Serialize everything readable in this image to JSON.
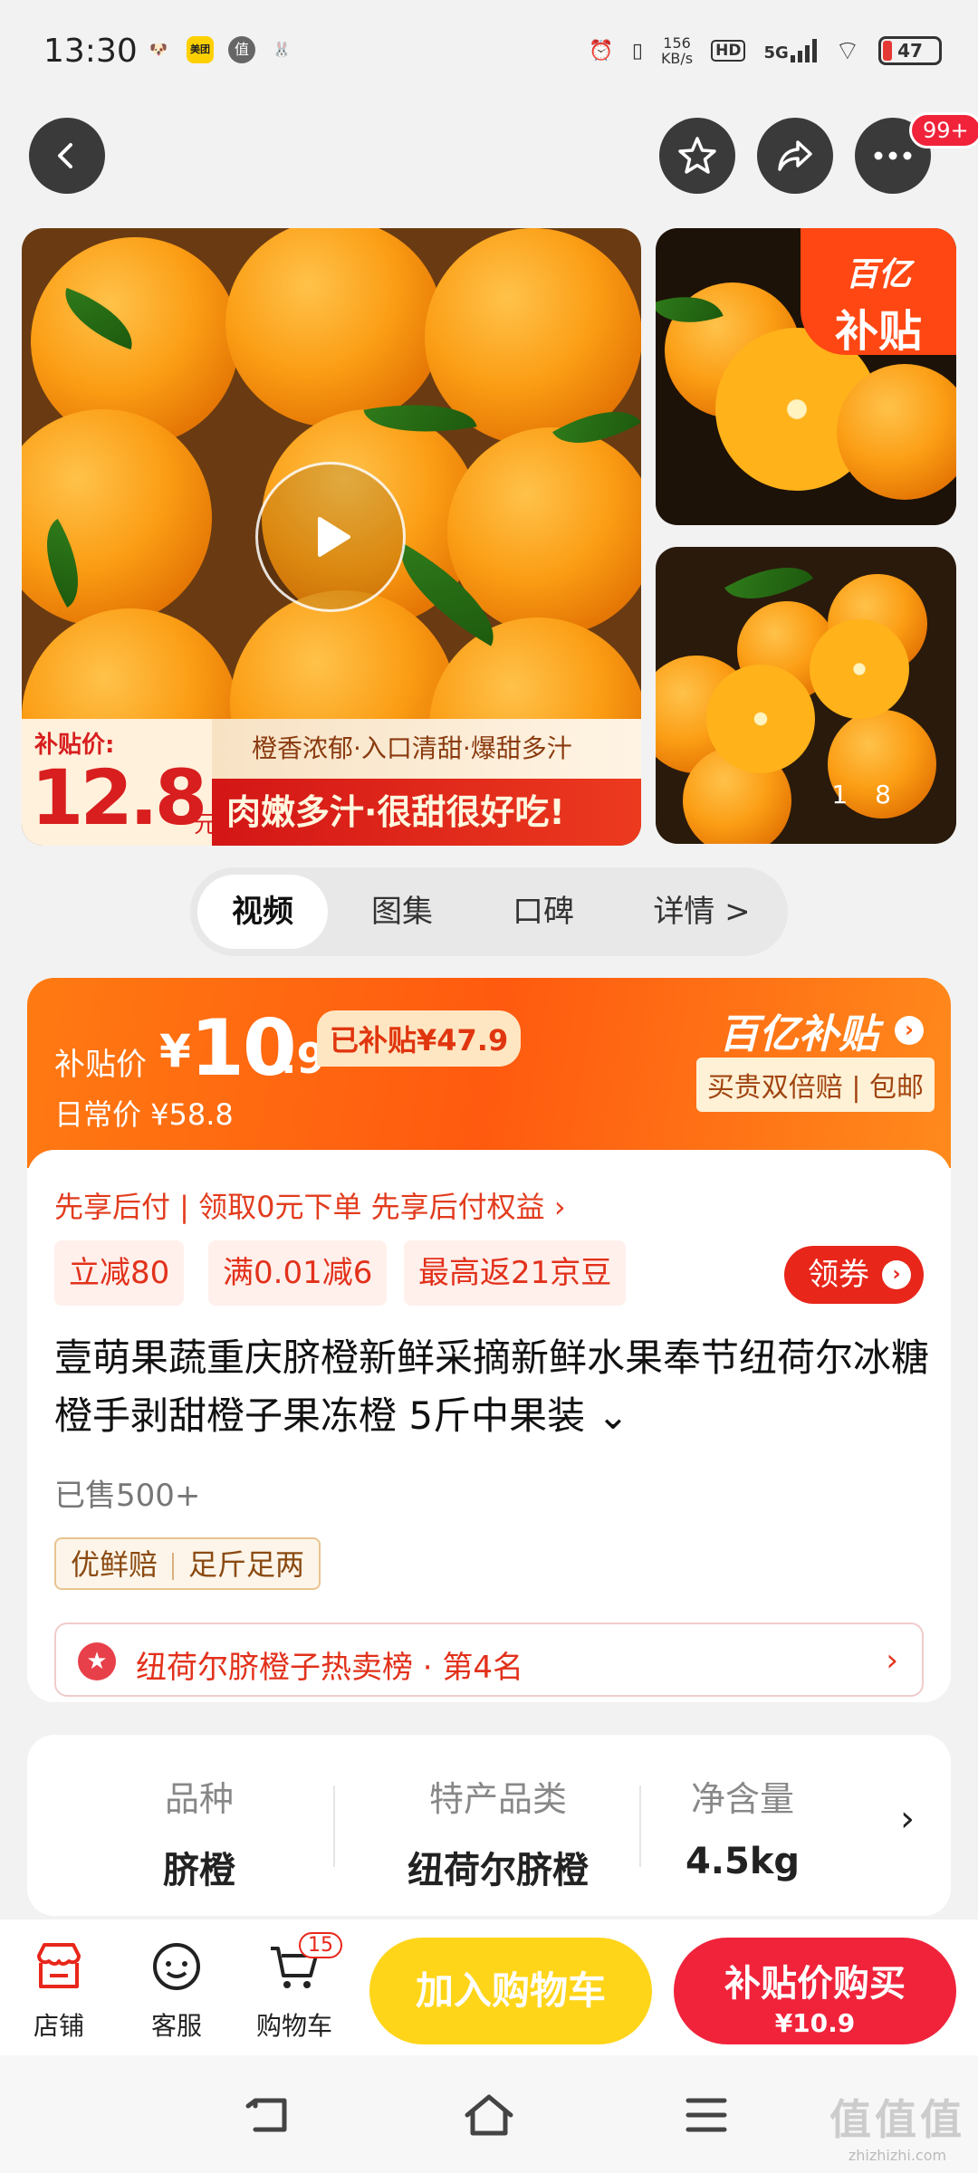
{
  "status_bar": {
    "time": "13:30",
    "app_icons": [
      {
        "name": "meituan-mascot-icon",
        "glyph": "🐶",
        "bg": "#ffffff"
      },
      {
        "name": "meituan-icon",
        "glyph": "美团",
        "bg": "#ffd000"
      },
      {
        "name": "zhide-icon",
        "glyph": "值",
        "bg": "#666666"
      },
      {
        "name": "rabbit-icon",
        "glyph": "🐰",
        "bg": "#ffffff"
      }
    ],
    "speed_top": "156",
    "speed_bottom": "KB/s",
    "hd": "HD",
    "network": "5G",
    "battery": "47"
  },
  "top_nav": {
    "badge": "99+"
  },
  "media": {
    "promo_label": "补贴价:",
    "promo_price": "12.8",
    "promo_unit": "元",
    "promo_tagline": "橙香浓郁·入口清甜·爆甜多汁",
    "promo_slogan": "肉嫩多汁·很甜很好吃!",
    "corner_line1": "百亿",
    "corner_line2": "补贴",
    "pager_current": "1",
    "pager_total": "8"
  },
  "tabs": [
    {
      "label": "视频",
      "active": true
    },
    {
      "label": "图集",
      "active": false
    },
    {
      "label": "口碑",
      "active": false
    },
    {
      "label": "详情 >",
      "active": false
    }
  ],
  "price": {
    "label": "补贴价",
    "yen": "¥",
    "integer": "10",
    "decimal": ".9",
    "subsidized": "已补贴¥47.9",
    "daily": "日常价 ¥58.8",
    "brand": "百亿补贴",
    "guarantee": "买贵双倍赔 | 包邮"
  },
  "body": {
    "pay_later": "先享后付 | 领取0元下单 先享后付权益 ›",
    "coupons": [
      "立减80",
      "满0.01减6",
      "最高返21京豆"
    ],
    "get_coupon": "领券",
    "title": "壹萌果蔬重庆脐橙新鲜采摘新鲜水果奉节纽荷尔冰糖橙手剥甜橙子果冻橙 5斤中果装 ⌄",
    "sold": "已售500+",
    "tags": [
      "优鲜赔",
      "足斤足两"
    ],
    "rank": "纽荷尔脐橙子热卖榜 · 第4名",
    "rank_arrow": "›"
  },
  "specs": [
    {
      "key": "品种",
      "value": "脐橙"
    },
    {
      "key": "特产品类",
      "value": "纽荷尔脐橙"
    },
    {
      "key": "净含量",
      "value": "4.5kg"
    }
  ],
  "action_bar": {
    "store": "店铺",
    "service": "客服",
    "cart": "购物车",
    "cart_count": "15",
    "add_to_cart": "加入购物车",
    "buy_line1": "补贴价购买",
    "buy_line2": "¥10.9"
  },
  "watermark": {
    "line1": "值值值",
    "line2": "zhizhizhi.com"
  },
  "colors": {
    "accent_red": "#f0233b",
    "accent_orange": "#ff5a0f",
    "accent_yellow": "#ffd51a"
  }
}
